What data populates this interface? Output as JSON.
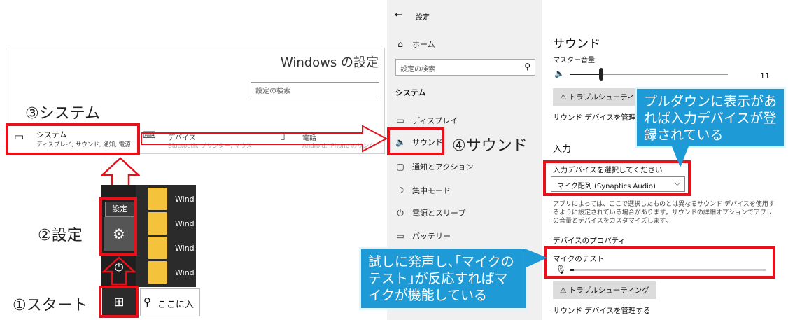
{
  "win_settings": {
    "title": "Windows の設定",
    "search_placeholder": "設定の検索",
    "system": {
      "label": "システム",
      "desc": "ディスプレイ, サウンド, 通知, 電源"
    },
    "devices": {
      "label": "デバイス",
      "desc": "Bluetooth, プリンター, マウス"
    },
    "phone": {
      "label": "電話",
      "desc": "Android, iPhone のリンク"
    }
  },
  "steps": {
    "system": "③システム",
    "settings": "②設定",
    "start": "①スタート",
    "sound": "④サウンド"
  },
  "start_menu": {
    "tooltip": "設定",
    "tiles": [
      "Wind",
      "Wind",
      "Wind",
      "Wind"
    ],
    "search_text": "ここに入"
  },
  "settings_nav": {
    "back": "←",
    "title": "設定",
    "home": "ホーム",
    "search_placeholder": "設定の検索",
    "section": "システム",
    "items": [
      "ディスプレイ",
      "サウンド",
      "通知とアクション",
      "集中モード",
      "電源とスリープ",
      "バッテリー"
    ]
  },
  "sound_page": {
    "title": "サウンド",
    "master_volume": "マスター音量",
    "volume_value": "11",
    "volume_level": 0.2,
    "troubleshoot": "⚠ トラブルシューティング",
    "manage_devices": "サウンド デバイスを管理する",
    "input_heading": "入力",
    "select_input_label": "入力デバイスを選択してください",
    "selected_device": "マイク配列 (Synaptics Audio)",
    "description": "アプリによっては、ここで選択したものとは異なるサウンド デバイスを使用するように設定されている場合があります。サウンドの詳細オプションでアプリの音量とデバイスをカスタマイズします。",
    "device_properties": "デバイスのプロパティ",
    "mic_test": "マイクのテスト",
    "mic_level": 0.02,
    "troubleshoot2": "⚠ トラブルシューティング",
    "manage_devices2": "サウンド デバイスを管理する"
  },
  "callouts": {
    "pulldown": "プルダウンに表示があれば入力デバイスが登録されている",
    "mic_test": "試しに発声し､｢マイクのテスト｣が反応すればマイクが機能している"
  },
  "colors": {
    "highlight": "#e8101a",
    "callout": "#1e9bd7",
    "tile": "#f5c33b"
  }
}
